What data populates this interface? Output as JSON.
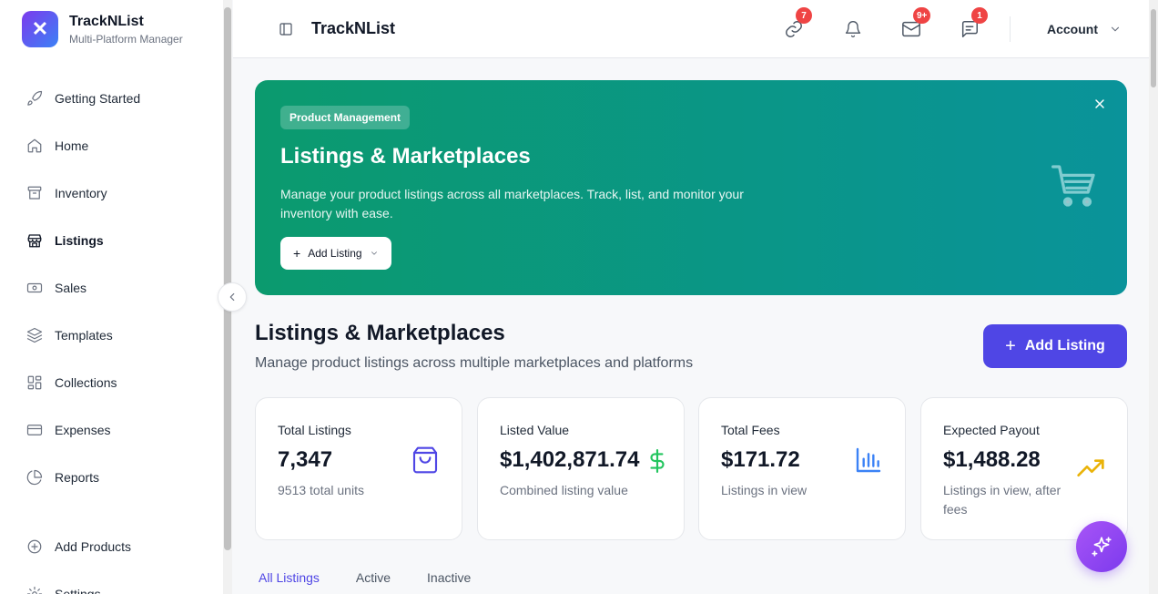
{
  "brand": {
    "title": "TrackNList",
    "subtitle": "Multi-Platform Manager"
  },
  "sidebar": {
    "items": [
      {
        "label": "Getting Started",
        "icon": "rocket-icon"
      },
      {
        "label": "Home",
        "icon": "home-icon"
      },
      {
        "label": "Inventory",
        "icon": "archive-icon"
      },
      {
        "label": "Listings",
        "icon": "store-icon",
        "active": true
      },
      {
        "label": "Sales",
        "icon": "banknote-icon"
      },
      {
        "label": "Templates",
        "icon": "layers-icon"
      },
      {
        "label": "Collections",
        "icon": "grid-icon"
      },
      {
        "label": "Expenses",
        "icon": "credit-card-icon"
      },
      {
        "label": "Reports",
        "icon": "pie-chart-icon"
      }
    ],
    "bottom": [
      {
        "label": "Add Products",
        "icon": "plus-circle-icon"
      },
      {
        "label": "Settings",
        "icon": "gear-icon"
      }
    ]
  },
  "header": {
    "title": "TrackNList",
    "badges": {
      "links": "7",
      "messages": "9+",
      "chat": "1"
    },
    "account": "Account"
  },
  "hero": {
    "tag": "Product Management",
    "title": "Listings & Marketplaces",
    "description": "Manage your product listings across all marketplaces. Track, list, and monitor your inventory with ease.",
    "button": "Add Listing"
  },
  "section": {
    "title": "Listings & Marketplaces",
    "subtitle": "Manage product listings across multiple marketplaces and platforms",
    "add_button": "Add Listing"
  },
  "cards": [
    {
      "label": "Total Listings",
      "value": "7,347",
      "sub": "9513 total units",
      "icon": "shopping-bag-icon",
      "color": "#4f46e5"
    },
    {
      "label": "Listed Value",
      "value": "$1,402,871.74",
      "sub": "Combined listing value",
      "icon": "dollar-icon",
      "color": "#22c55e"
    },
    {
      "label": "Total Fees",
      "value": "$171.72",
      "sub": "Listings in view",
      "icon": "bar-chart-icon",
      "color": "#3b82f6"
    },
    {
      "label": "Expected Payout",
      "value": "$1,488.28",
      "sub": "Listings in view, after fees",
      "icon": "trending-up-icon",
      "color": "#eab308"
    }
  ],
  "tabs": [
    "All Listings",
    "Active",
    "Inactive"
  ]
}
